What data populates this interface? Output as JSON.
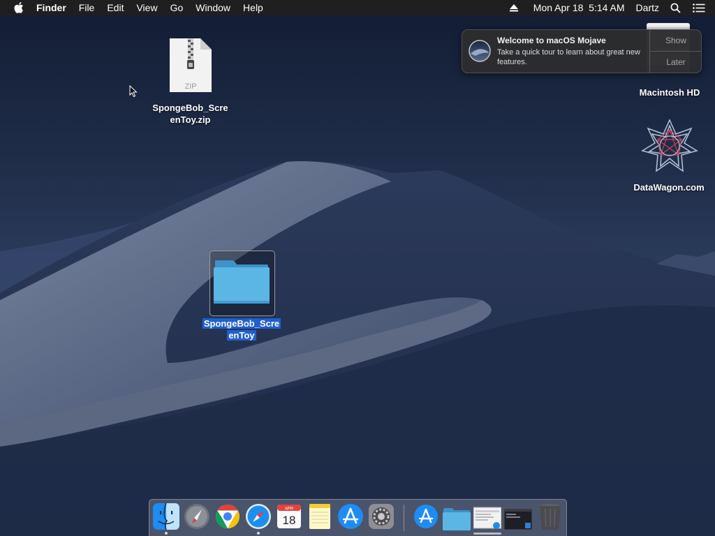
{
  "menubar": {
    "apple_icon": "apple-logo",
    "app_name": "Finder",
    "menus": [
      "File",
      "Edit",
      "View",
      "Go",
      "Window"
    ],
    "help": "Help",
    "datetime": "Mon Apr 18  5:14 AM",
    "user": "Dartz",
    "icons": [
      "eject-icon",
      "spotlight-search-icon",
      "notification-center-icon"
    ]
  },
  "desktop": {
    "zip_file": {
      "line1": "SpongeBob_Scre",
      "line2": "enToy.zip",
      "badge": "ZIP"
    },
    "folder": {
      "line1": "SpongeBob_Scre",
      "line2": "enToy",
      "selected": true
    },
    "macintosh_hd": {
      "label": "Macintosh HD"
    },
    "datawagon": {
      "label": "DataWagon.com"
    }
  },
  "notification": {
    "title": "Welcome to macOS Mojave",
    "body": "Take a quick tour to learn about great new features.",
    "show_label": "Show",
    "later_label": "Later"
  },
  "dock": {
    "calendar_month": "APR",
    "calendar_day": "18",
    "items": [
      "Finder",
      "Launchpad",
      "Google Chrome",
      "Safari",
      "Calendar",
      "Notes",
      "App Store",
      "System Preferences",
      "Applications",
      "Downloads",
      "Screenshot",
      "Terminal Window",
      "Trash"
    ]
  },
  "colors": {
    "menubar": "#1f1f21",
    "selection": "#1f5fd1",
    "folder": "#5bb6e6"
  }
}
